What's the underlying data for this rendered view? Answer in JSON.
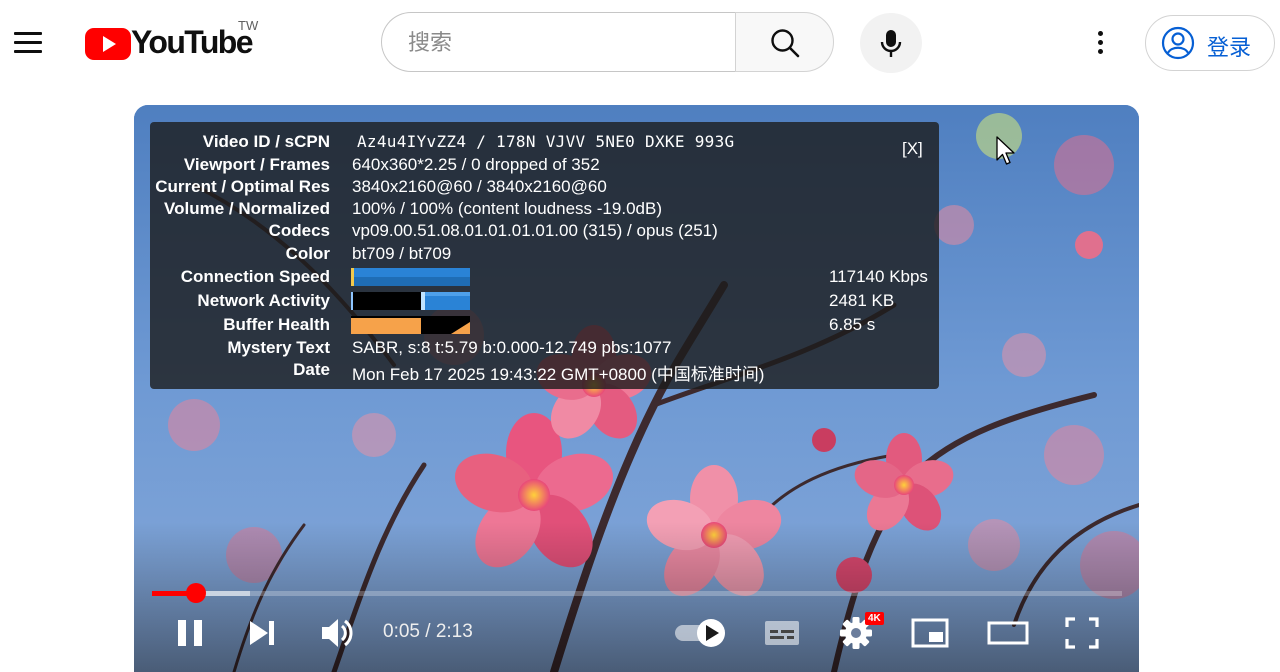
{
  "masthead": {
    "logo_text": "YouTube",
    "region_code": "TW",
    "search_placeholder": "搜索",
    "signin_label": "登录",
    "icons": [
      "menu-icon",
      "youtube-logo-icon",
      "search-icon",
      "microphone-icon",
      "more-vertical-icon",
      "account-circle-icon"
    ]
  },
  "stats_for_nerds": {
    "close_label": "[X]",
    "rows": [
      {
        "label": "Video ID / sCPN",
        "value": "Az4u4IYvZZ4 / 178N VJVV 5NE0 DXKE 993G"
      },
      {
        "label": "Viewport / Frames",
        "value": "640x360*2.25 / 0 dropped of 352"
      },
      {
        "label": "Current / Optimal Res",
        "value": "3840x2160@60 / 3840x2160@60"
      },
      {
        "label": "Volume / Normalized",
        "value": "100% / 100% (content loudness -19.0dB)"
      },
      {
        "label": "Codecs",
        "value": "vp09.00.51.08.01.01.01.01.00 (315) / opus (251)"
      },
      {
        "label": "Color",
        "value": "bt709 / bt709"
      },
      {
        "label": "Connection Speed",
        "value": "117140 Kbps"
      },
      {
        "label": "Network Activity",
        "value": "2481 KB"
      },
      {
        "label": "Buffer Health",
        "value": "6.85 s"
      },
      {
        "label": "Mystery Text",
        "value": "SABR, s:8 t:5.79 b:0.000-12.749 pbs:1077"
      },
      {
        "label": "Date",
        "value": "Mon Feb 17 2025 19:43:22 GMT+0800 (中国标准时间)"
      }
    ]
  },
  "player": {
    "current_time": "0:05",
    "duration": "2:13",
    "time_display": "0:05 / 2:13",
    "played_fraction": 0.045,
    "buffered_fraction": 0.101,
    "quality_badge": "4K",
    "autoplay_on": true,
    "accent_color": "#ff0000",
    "controls": [
      "pause-icon",
      "next-icon",
      "volume-icon",
      "autoplay-toggle",
      "subtitles-icon",
      "settings-icon",
      "miniplayer-icon",
      "theater-mode-icon",
      "fullscreen-icon"
    ]
  }
}
